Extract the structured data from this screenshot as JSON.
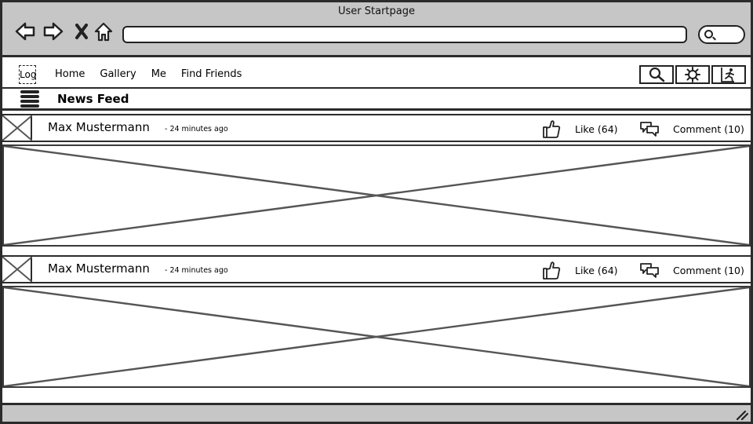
{
  "window": {
    "title": "User Startpage"
  },
  "browser": {
    "url": "",
    "back_icon": "back-arrow-icon",
    "forward_icon": "forward-arrow-icon",
    "stop_icon": "close-icon",
    "home_icon": "home-icon",
    "search_icon": "search-icon"
  },
  "topnav": {
    "logo_label": "Log",
    "menu": [
      "Home",
      "Gallery",
      "Me",
      "Find Friends"
    ],
    "icon_buttons": [
      "search-icon",
      "gear-icon",
      "exit-icon"
    ]
  },
  "feed": {
    "title": "News Feed"
  },
  "posts": [
    {
      "author": "Max Mustermann",
      "time": "- 24 minutes ago",
      "like_label": "Like (64)",
      "comment_label": "Comment (10)"
    },
    {
      "author": "Max Mustermann",
      "time": "- 24 minutes ago",
      "like_label": "Like (64)",
      "comment_label": "Comment (10)"
    }
  ],
  "colors": {
    "chrome": "#c6c6c6",
    "border": "#2b2b2b",
    "placeholder_stroke": "#555555"
  }
}
